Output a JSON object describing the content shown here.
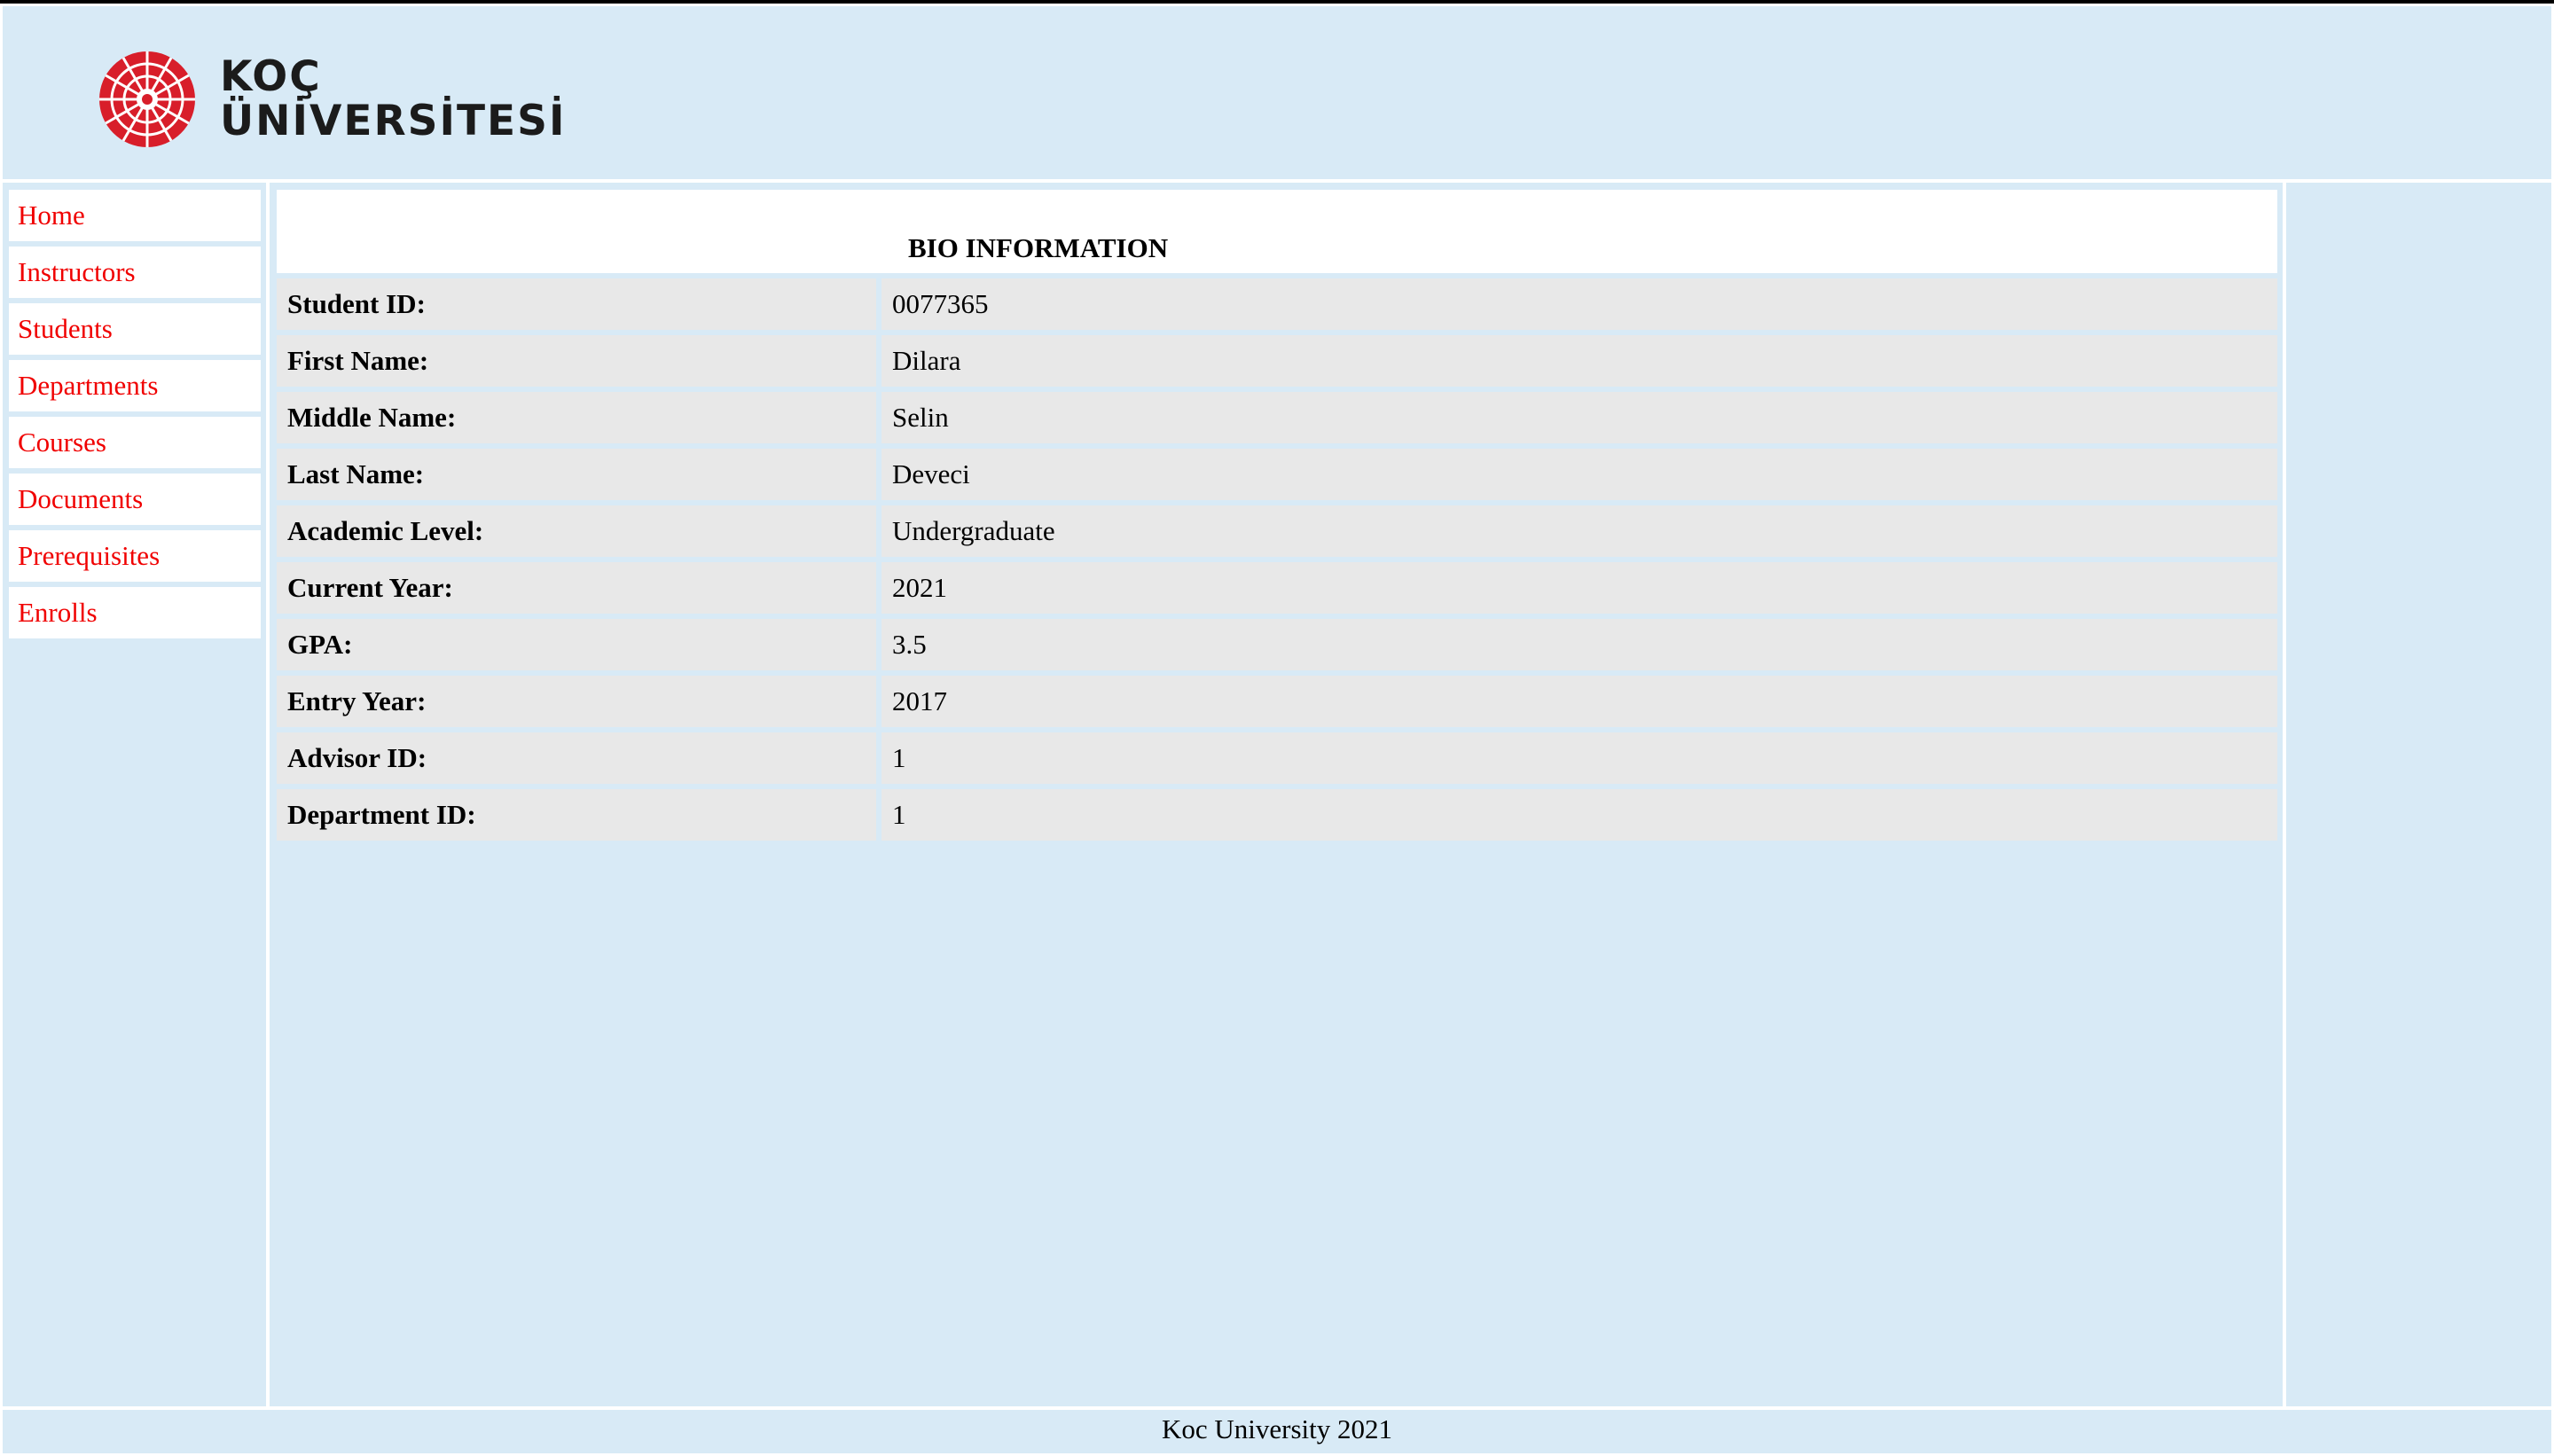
{
  "logo": {
    "line1": "KOÇ",
    "line2": "ÜNİVERSİTESİ",
    "emblem": "koc-university-emblem-icon",
    "emblem_color": "#d81e2a"
  },
  "sidebar": {
    "items": [
      {
        "label": "Home"
      },
      {
        "label": "Instructors"
      },
      {
        "label": "Students"
      },
      {
        "label": "Departments"
      },
      {
        "label": "Courses"
      },
      {
        "label": "Documents"
      },
      {
        "label": "Prerequisites"
      },
      {
        "label": "Enrolls"
      }
    ],
    "link_color": "#f00000"
  },
  "bio": {
    "title": "BIO INFORMATION",
    "rows": [
      {
        "label": "Student ID:",
        "value": "0077365"
      },
      {
        "label": "First Name:",
        "value": "Dilara"
      },
      {
        "label": "Middle Name:",
        "value": "Selin"
      },
      {
        "label": "Last Name:",
        "value": "Deveci"
      },
      {
        "label": "Academic Level:",
        "value": "Undergraduate"
      },
      {
        "label": "Current Year:",
        "value": "2021"
      },
      {
        "label": "GPA:",
        "value": "3.5"
      },
      {
        "label": "Entry Year:",
        "value": "2017"
      },
      {
        "label": "Advisor ID:",
        "value": "1"
      },
      {
        "label": "Department ID:",
        "value": "1"
      }
    ]
  },
  "footer": {
    "text": "Koc University 2021"
  },
  "colors": {
    "background": "#d8eaf6",
    "row_background": "#e8e8e8",
    "panel": "#ffffff"
  }
}
